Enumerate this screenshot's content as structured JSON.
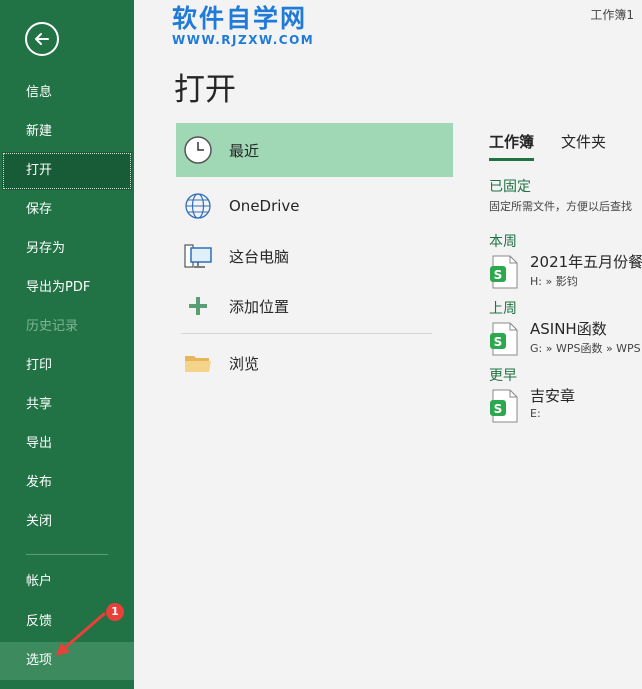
{
  "sidebar": {
    "items": [
      {
        "label": "信息",
        "state": "normal"
      },
      {
        "label": "新建",
        "state": "normal"
      },
      {
        "label": "打开",
        "state": "active"
      },
      {
        "label": "保存",
        "state": "normal"
      },
      {
        "label": "另存为",
        "state": "normal"
      },
      {
        "label": "导出为PDF",
        "state": "normal"
      },
      {
        "label": "历史记录",
        "state": "disabled"
      },
      {
        "label": "打印",
        "state": "normal"
      },
      {
        "label": "共享",
        "state": "normal"
      },
      {
        "label": "导出",
        "state": "normal"
      },
      {
        "label": "发布",
        "state": "normal"
      },
      {
        "label": "关闭",
        "state": "normal"
      },
      {
        "label": "帐户",
        "state": "normal"
      },
      {
        "label": "反馈",
        "state": "normal"
      },
      {
        "label": "选项",
        "state": "selected"
      }
    ]
  },
  "watermark": {
    "main": "软件自学网",
    "sub": "WWW.RJZXW.COM"
  },
  "window_title": "工作簿1",
  "page_title": "打开",
  "locations": [
    {
      "label": "最近",
      "icon": "clock-icon"
    },
    {
      "label": "OneDrive",
      "icon": "globe-icon"
    },
    {
      "label": "这台电脑",
      "icon": "computer-icon"
    },
    {
      "label": "添加位置",
      "icon": "plus-icon"
    },
    {
      "label": "浏览",
      "icon": "folder-icon"
    }
  ],
  "tabs": {
    "workbooks": "工作簿",
    "folders": "文件夹"
  },
  "sections": {
    "pinned": "已固定",
    "pinned_desc": "固定所需文件，方便以后查找",
    "this_week": "本周",
    "last_week": "上周",
    "earlier": "更早"
  },
  "files": [
    {
      "name": "2021年五月份餐",
      "path": "H: » 影钧"
    },
    {
      "name": "ASINH函数",
      "path": "G: » WPS函数 » WPS"
    },
    {
      "name": "吉安章",
      "path": "E:"
    }
  ],
  "annotation": {
    "badge": "1"
  },
  "colors": {
    "accent": "#217346",
    "active_item": "#a0d8b6",
    "badge": "#e8413a"
  }
}
